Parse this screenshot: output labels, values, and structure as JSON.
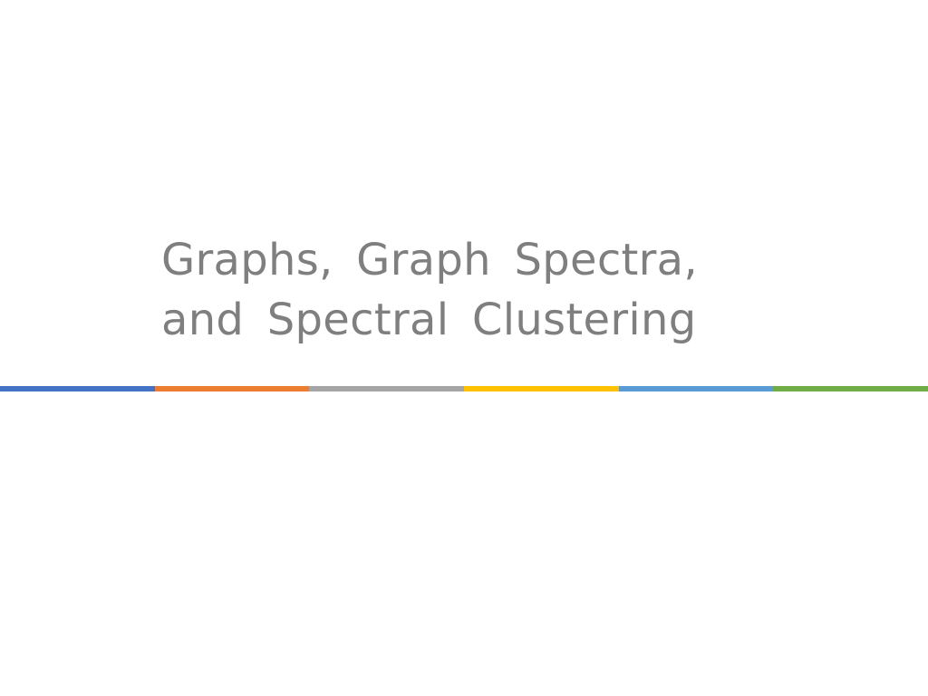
{
  "slide": {
    "title_lines": [
      "Graphs, Graph Spectra,",
      "and Spectral Clustering"
    ]
  },
  "colors": {
    "title_text": "#7f7f7f",
    "background": "#ffffff",
    "bar_segments": [
      "#4472c4",
      "#ed7d31",
      "#a5a5a5",
      "#ffc000",
      "#5b9bd5",
      "#70ad47"
    ]
  }
}
